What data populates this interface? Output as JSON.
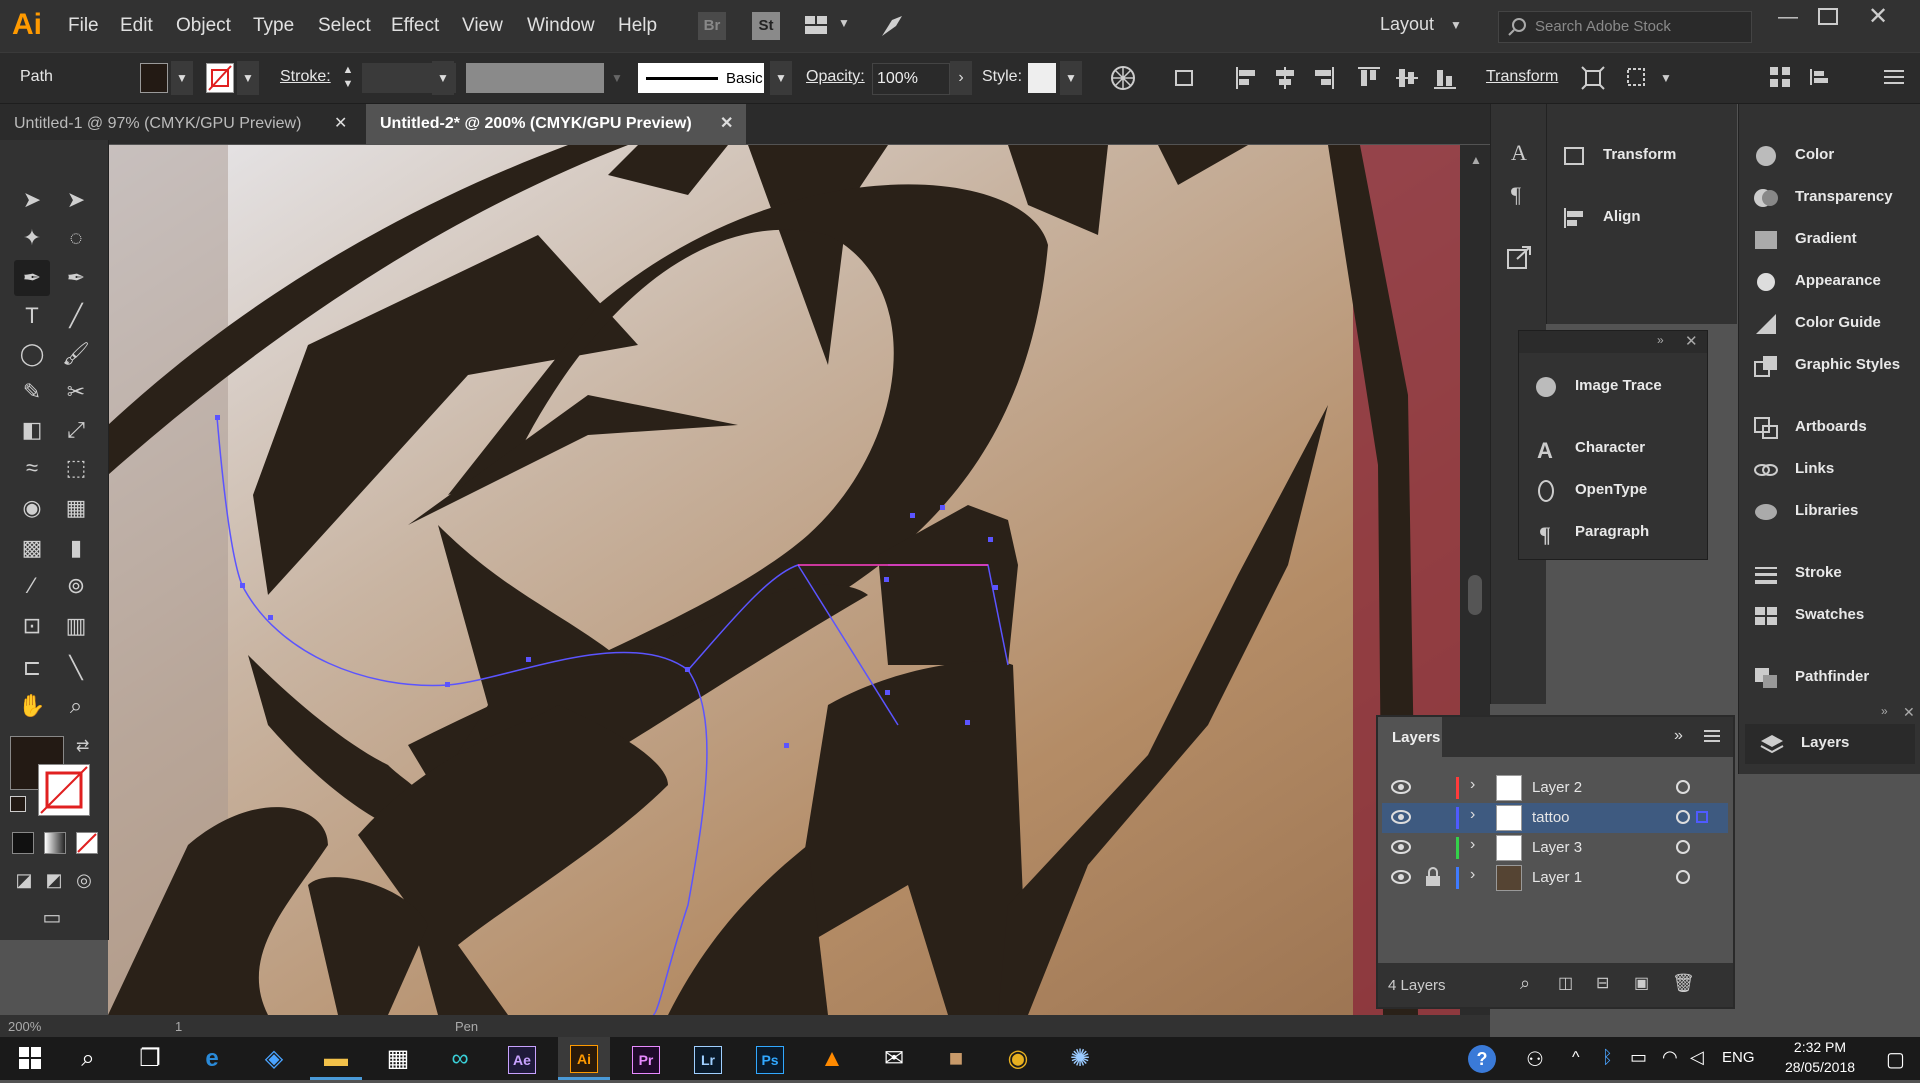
{
  "app": {
    "logo": "Ai",
    "menu": [
      "File",
      "Edit",
      "Object",
      "Type",
      "Select",
      "Effect",
      "View",
      "Window",
      "Help"
    ],
    "bridge_label": "Br",
    "stock_label": "St",
    "workspace": "Layout",
    "search_placeholder": "Search Adobe Stock"
  },
  "control": {
    "selection_type": "Path",
    "stroke_label": "Stroke:",
    "brush_label": "Basic",
    "opacity_label": "Opacity:",
    "opacity_value": "100%",
    "style_label": "Style:",
    "transform_label": "Transform"
  },
  "tabs": [
    {
      "label": "Untitled-1 @ 97% (CMYK/GPU Preview)",
      "active": false
    },
    {
      "label": "Untitled-2* @ 200% (CMYK/GPU Preview)",
      "active": true
    }
  ],
  "panels": {
    "col1": [
      "Transform",
      "Align"
    ],
    "floating": [
      "Image Trace",
      "Character",
      "OpenType",
      "Paragraph"
    ],
    "col2": [
      "Color",
      "Transparency",
      "Gradient",
      "Appearance",
      "Color Guide",
      "Graphic Styles",
      "Artboards",
      "Links",
      "Libraries",
      "Stroke",
      "Swatches",
      "Pathfinder",
      "Layers"
    ]
  },
  "layers": {
    "title": "Layers",
    "rows": [
      {
        "name": "Layer 2",
        "color": "#ff3b3b",
        "locked": false,
        "selected": false
      },
      {
        "name": "tattoo",
        "color": "#4f5bff",
        "locked": false,
        "selected": true
      },
      {
        "name": "Layer 3",
        "color": "#34d14a",
        "locked": false,
        "selected": false
      },
      {
        "name": "Layer 1",
        "color": "#3f7bff",
        "locked": true,
        "selected": false
      }
    ],
    "count": "4 Layers"
  },
  "status": {
    "zoom": "200%",
    "artboard": "1",
    "tool": "Pen"
  },
  "taskbar": {
    "lang": "ENG",
    "time": "2:32 PM",
    "date": "28/05/2018",
    "apps": [
      "Ae",
      "Ai",
      "Pr",
      "Lr",
      "Ps"
    ]
  },
  "colors": {
    "accent": "#ff9a00",
    "art": "#2a2118",
    "selection_path": "#5b54ff"
  }
}
